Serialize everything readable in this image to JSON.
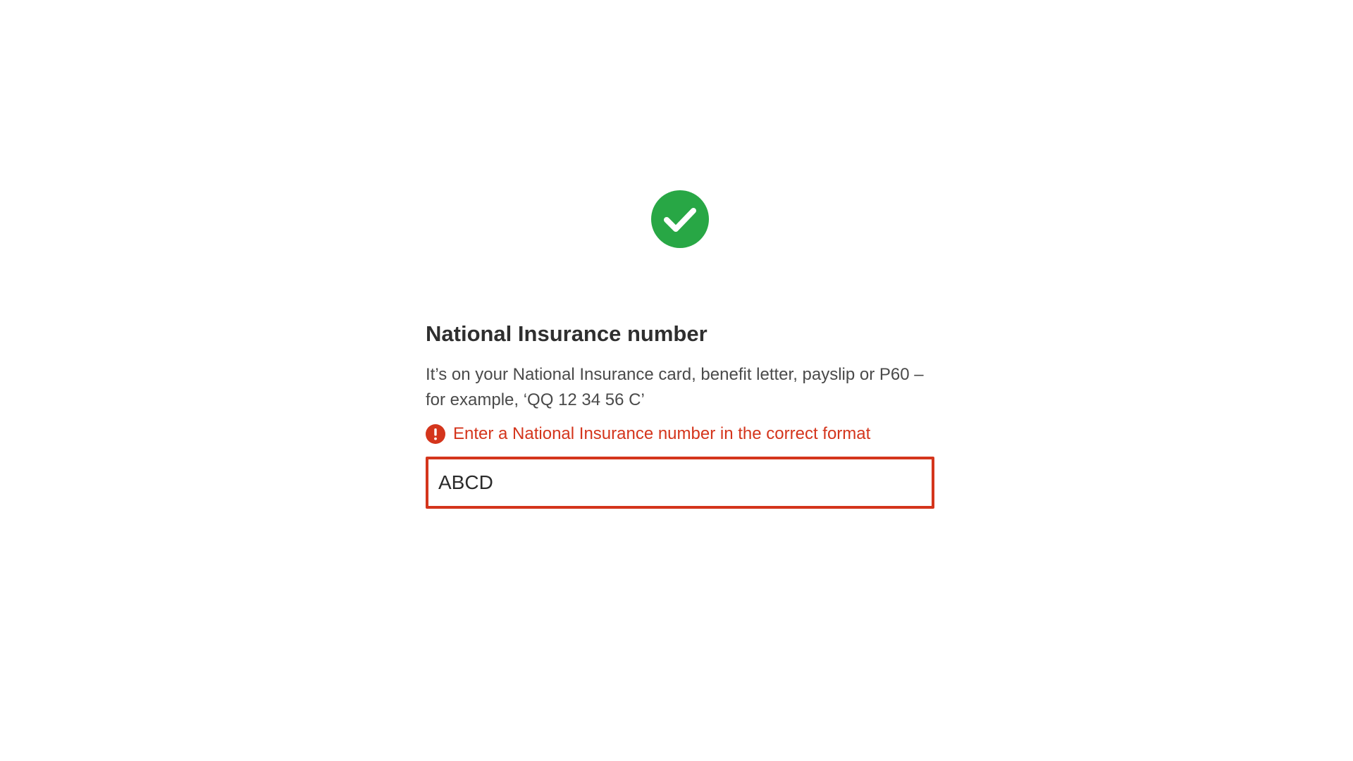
{
  "icons": {
    "success": "check-circle-icon",
    "error": "exclamation-circle-icon"
  },
  "colors": {
    "success_green": "#28a745",
    "error_red": "#d4351c",
    "text": "#2f2f2f"
  },
  "field": {
    "label": "National Insurance number",
    "hint": "It’s on your National Insurance card, benefit letter, payslip or P60 – for example, ‘QQ 12 34 56 C’",
    "error_message": "Enter a National Insurance number in the correct format",
    "value": "ABCD"
  }
}
